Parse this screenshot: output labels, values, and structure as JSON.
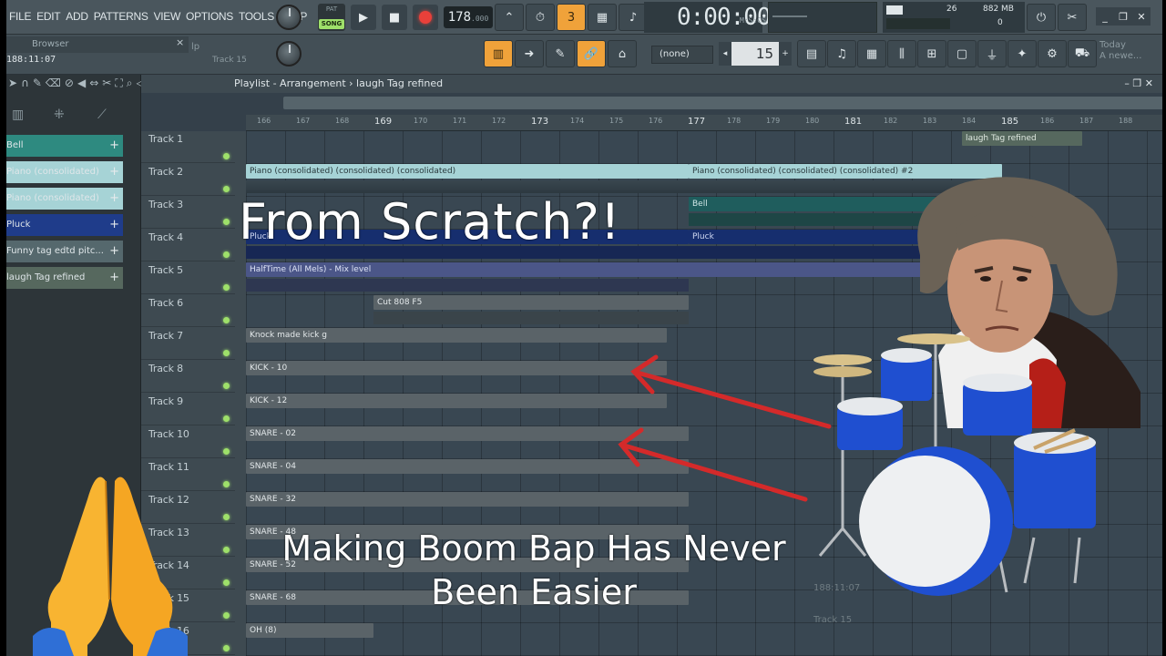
{
  "menu": [
    "FILE",
    "EDIT",
    "ADD",
    "PATTERNS",
    "VIEW",
    "OPTIONS",
    "TOOLS",
    "HELP"
  ],
  "transport": {
    "mode": "SONG",
    "mode_other": "PAT",
    "play": "▶",
    "stop": "■",
    "tempo": "178",
    "tempo_decimal": ".000"
  },
  "time_display": {
    "value": "0:00:00",
    "unit": "M:S:CS"
  },
  "cpu": {
    "value": "26",
    "memory": "882 MB",
    "polyphony": "0"
  },
  "browser": {
    "title": "Browser",
    "time": "188:11:07",
    "hint": "lp",
    "track": "Track 15"
  },
  "pattern_select": {
    "value": "(none)"
  },
  "step": {
    "value": "15"
  },
  "news": {
    "line1": "Today",
    "line2": "A newe..."
  },
  "playlist": {
    "title": "Playlist - Arrangement › laugh Tag refined"
  },
  "browser_clips": [
    {
      "label": "Bell",
      "color": "#2e8a80"
    },
    {
      "label": "Piano  (consolidated)",
      "color": "#a6d3d6"
    },
    {
      "label": "Piano  (consolidated)",
      "color": "#a6d3d6"
    },
    {
      "label": "Pluck",
      "color": "#1f3c8a"
    },
    {
      "label": "Funny tag edtd pitc...",
      "color": "#55686d"
    },
    {
      "label": "laugh Tag refined",
      "color": "#56685e"
    }
  ],
  "ruler": [
    "166",
    "167",
    "168",
    "169",
    "170",
    "171",
    "172",
    "173",
    "174",
    "175",
    "176",
    "177",
    "178",
    "179",
    "180",
    "181",
    "182",
    "183",
    "184",
    "185",
    "186",
    "187",
    "188"
  ],
  "tracks": [
    "Track 1",
    "Track 2",
    "Track 3",
    "Track 4",
    "Track 5",
    "Track 6",
    "Track 7",
    "Track 8",
    "Track 9",
    "Track 10",
    "Track 11",
    "Track 12",
    "Track 13",
    "Track 14",
    "Track 15",
    "Track 16"
  ],
  "clips": {
    "laugh": "laugh Tag refined",
    "piano_a": "Piano  (consolidated) (consolidated) (consolidated)",
    "piano_b": "Piano  (consolidated) (consolidated) (consolidated) #2",
    "bell": "Bell",
    "pluck_a": "Pluck",
    "pluck_b": "Pluck",
    "halftime": "HalfTime (All Mels) - Mix level",
    "cut808": "Cut 808 F5",
    "knock": "Knock made kick g",
    "kick10": "KICK - 10",
    "kick12": "KICK - 12",
    "snare02": "SNARE - 02",
    "snare04": "SNARE - 04",
    "snare32": "SNARE - 32",
    "snare48": "SNARE - 48",
    "snare52": "SNARE - 52",
    "snare68": "SNARE - 68",
    "oh": "OH (8)"
  },
  "overlay": {
    "title": "From Scratch?!",
    "subtitle_line1": "Making Boom Bap Has Never",
    "subtitle_line2": "Been Easier"
  },
  "ghost": {
    "time": "188:11:07",
    "track": "Track 15"
  },
  "colors": {
    "accent": "#f0a23a",
    "song_green": "#9ee06a",
    "record": "#e8403a",
    "arrow": "#d42a2a"
  }
}
